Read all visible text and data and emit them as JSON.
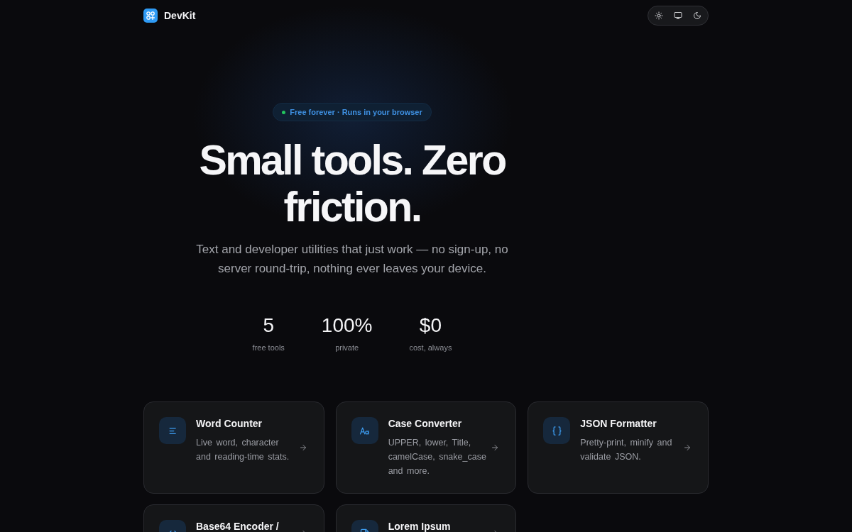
{
  "header": {
    "brand": "DevKit",
    "theme_options": [
      {
        "kind": "light"
      },
      {
        "kind": "system"
      },
      {
        "kind": "dark"
      }
    ]
  },
  "hero": {
    "badge": "Free forever · Runs in your browser",
    "title": "Small tools. Zero friction.",
    "subtitle": "Text and developer utilities that just work — no sign-up, no server round-trip, nothing ever leaves your device.",
    "stats": [
      {
        "value": "5",
        "label": "free tools"
      },
      {
        "value": "100%",
        "label": "private"
      },
      {
        "value": "$0",
        "label": "cost, always"
      }
    ]
  },
  "tools": [
    {
      "kind": "text-stats",
      "title": "Word Counter",
      "description": "Live word, character and reading-time stats."
    },
    {
      "kind": "case",
      "title": "Case Converter",
      "description": "UPPER, lower, Title, camelCase, snake_case and more."
    },
    {
      "kind": "json",
      "title": "JSON Formatter",
      "description": "Pretty-print, minify and validate JSON."
    },
    {
      "kind": "code",
      "title": "Base64 Encoder /"
    },
    {
      "kind": "file",
      "title": "Lorem Ipsum"
    }
  ]
}
